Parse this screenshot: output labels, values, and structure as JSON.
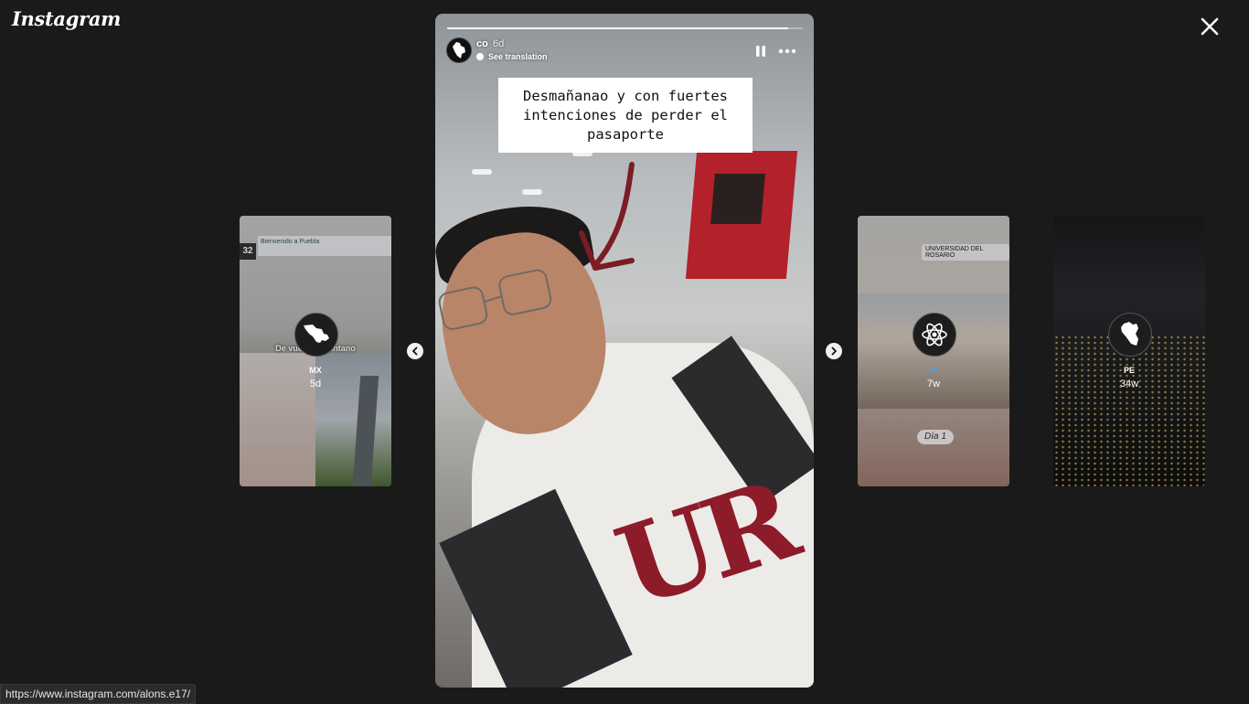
{
  "app": {
    "logo_text": "Instagram"
  },
  "main_story": {
    "username": "co",
    "time_ago": "6d",
    "see_translation": "See translation",
    "caption": "Desmañanao y con fuertes intenciones de perder el pasaporte",
    "progress": 0.96
  },
  "previews": [
    {
      "name": "MX",
      "time_ago": "5d",
      "overlay_text": "De vuelta al pantano",
      "sign_text": "Bienvenido a Puebla",
      "platform_number": "32"
    },
    {
      "name": "",
      "time_ago": "7w",
      "location": "UNIVERSIDAD DEL ROSARIO",
      "sticker": "Día 1"
    },
    {
      "name": "PE",
      "time_ago": "34w"
    }
  ],
  "status_bar": {
    "url": "https://www.instagram.com/alons.e17/"
  },
  "icons": {
    "close": "close-icon",
    "prev": "chevron-left-icon",
    "next": "chevron-right-icon",
    "pause": "pause-icon",
    "more": "more-icon"
  }
}
